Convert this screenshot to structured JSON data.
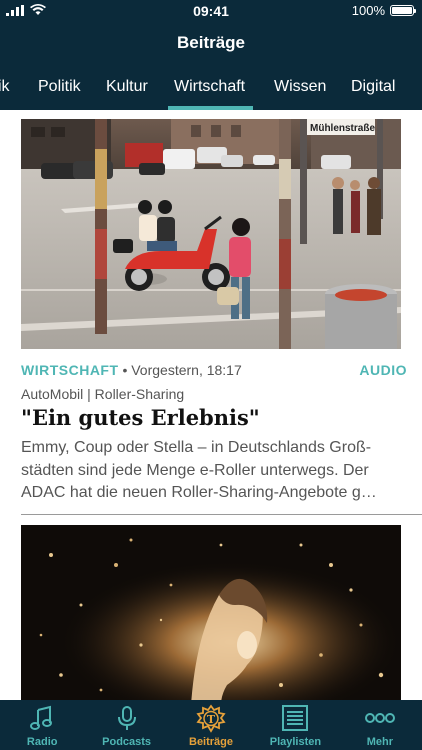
{
  "status_bar": {
    "time": "09:41",
    "battery": "100%"
  },
  "header": {
    "title": "Beiträge"
  },
  "tabs": [
    {
      "label": "ik"
    },
    {
      "label": "Politik"
    },
    {
      "label": "Kultur"
    },
    {
      "label": "Wirtschaft",
      "active": true
    },
    {
      "label": "Wissen"
    },
    {
      "label": "Digital"
    }
  ],
  "article": {
    "category": "WIRTSCHAFT",
    "separator": "•",
    "date": "Vorgestern, 18:17",
    "badge": "AUDIO",
    "kicker": "AutoMobil | Roller-Sharing",
    "headline": "\"Ein gutes Erlebnis\"",
    "teaser": "Emmy, Coup oder Stella – in Deutschlands Groß­städten sind jede Menge e-Roller unterwegs. Der ADAC hat die neuen Roller-Sharing-Angebote g…",
    "image_sign": "Mühlenstraße"
  },
  "tabbar": [
    {
      "label": "Radio",
      "icon": "music-note-icon"
    },
    {
      "label": "Podcasts",
      "icon": "microphone-icon"
    },
    {
      "label": "Beiträge",
      "icon": "beitraege-badge-icon",
      "active": true
    },
    {
      "label": "Playlisten",
      "icon": "playlist-icon"
    },
    {
      "label": "Mehr",
      "icon": "more-dots-icon"
    }
  ],
  "colors": {
    "navy": "#0b2a3a",
    "accent": "#4fb6b4",
    "active_orange": "#e6a13a"
  }
}
